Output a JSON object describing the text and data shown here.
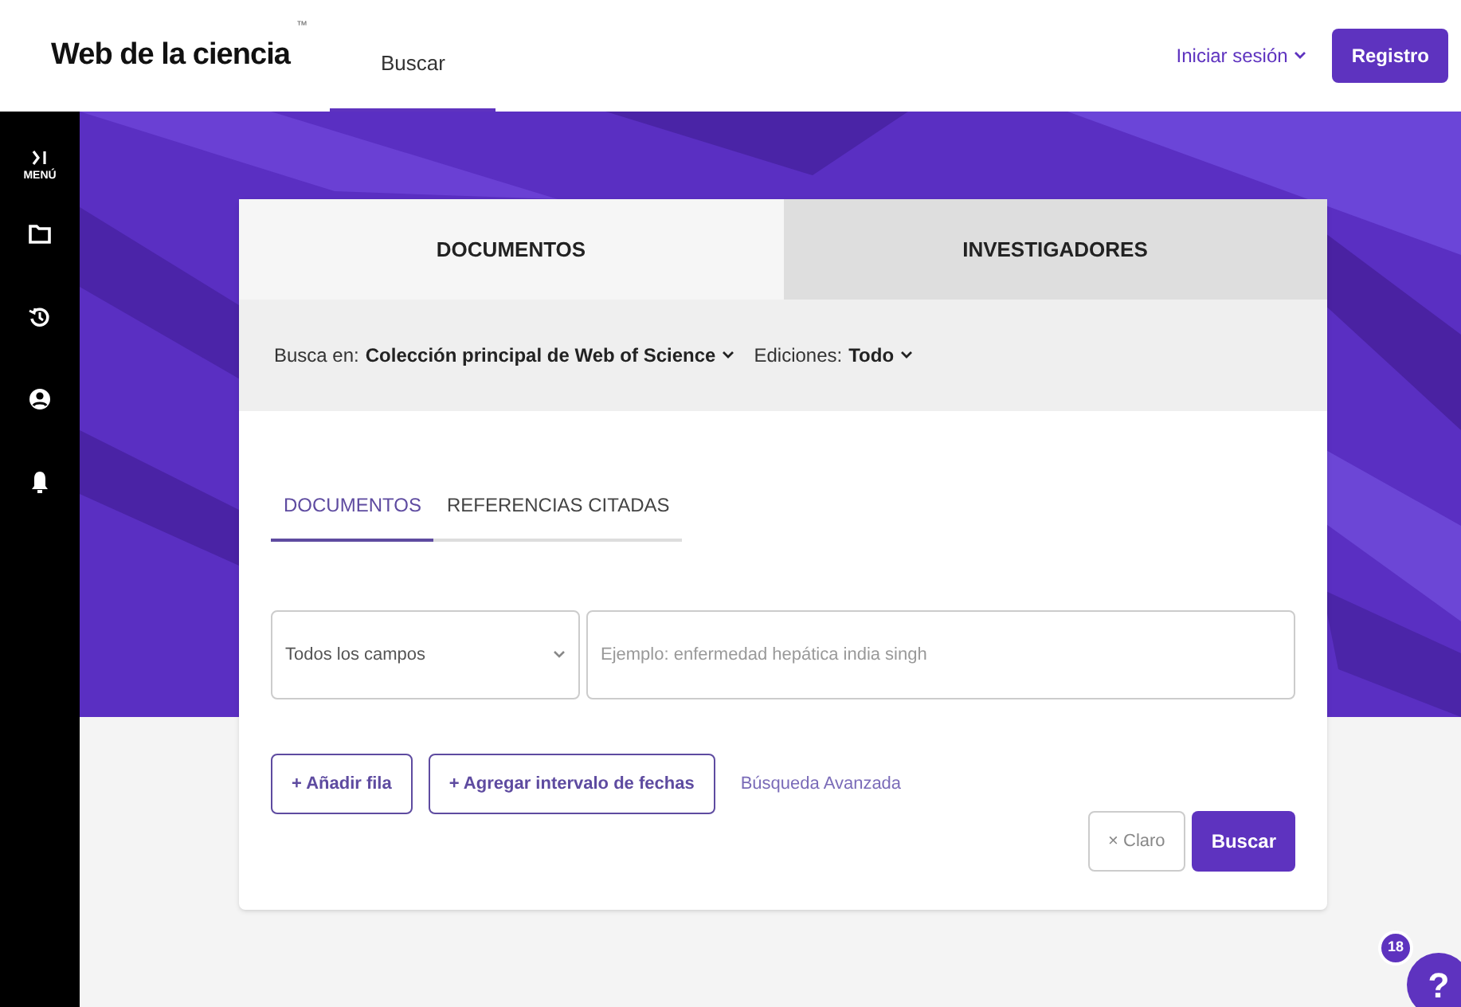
{
  "header": {
    "logo": "Web de la ciencia",
    "trademark": "™",
    "nav": [
      {
        "label": "Buscar",
        "selected": true
      }
    ],
    "sign_in": "Iniciar sesión",
    "register": "Registro"
  },
  "sidebar": {
    "menu_label": "MENÚ",
    "items": [
      {
        "kind": "folder"
      },
      {
        "kind": "history"
      },
      {
        "kind": "user"
      },
      {
        "kind": "bell"
      }
    ]
  },
  "search_card": {
    "tabs": [
      {
        "label": "DOCUMENTOS",
        "selected": true
      },
      {
        "label": "INVESTIGADORES",
        "selected": false
      }
    ],
    "search_in_label": "Busca en:",
    "collection": "Colección principal de Web of Science",
    "editions_label": "Ediciones:",
    "editions": "Todo",
    "subtabs": [
      {
        "label": "DOCUMENTOS",
        "selected": true
      },
      {
        "label": "REFERENCIAS CITADAS",
        "selected": false
      }
    ],
    "field_select": "Todos los campos",
    "query_placeholder": "Ejemplo: enfermedad hepática india singh",
    "add_row": "+ Añadir fila",
    "add_date_range": "+ Agregar intervalo de fechas",
    "advanced_search": "Búsqueda Avanzada",
    "clear": "× Claro",
    "search": "Buscar"
  },
  "help": {
    "badge": "18",
    "label": "?"
  }
}
